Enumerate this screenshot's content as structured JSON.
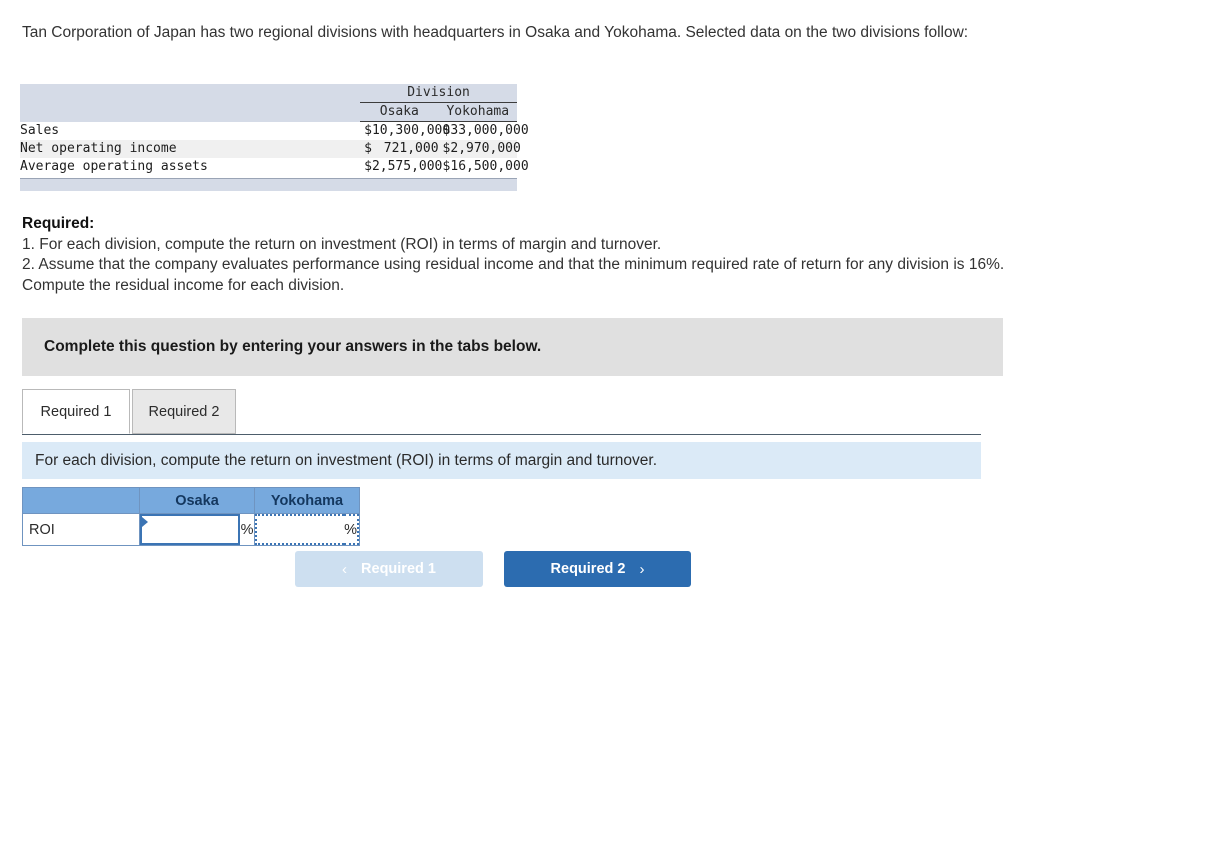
{
  "intro": "Tan Corporation of Japan has two regional divisions with headquarters in Osaka and Yokohama. Selected data on the two divisions follow:",
  "given_table": {
    "group_header": "Division",
    "columns": [
      "Osaka",
      "Yokohama"
    ],
    "rows": [
      {
        "label": "Sales",
        "osaka": "10,300,000",
        "yokohama": "33,000,000",
        "currency": "$"
      },
      {
        "label": "Net operating income",
        "osaka": "721,000",
        "yokohama": "2,970,000",
        "currency": "$"
      },
      {
        "label": "Average operating assets",
        "osaka": "2,575,000",
        "yokohama": "16,500,000",
        "currency": "$"
      }
    ]
  },
  "required": {
    "heading": "Required:",
    "item1": "1. For each division, compute the return on investment (ROI) in terms of margin and turnover.",
    "item2": "2. Assume that the company evaluates performance using residual income and that the minimum required rate of return for any division is 16%. Compute the residual income for each division."
  },
  "callout": "Complete this question by entering your answers in the tabs below.",
  "tabs": [
    {
      "label": "Required 1",
      "active": true
    },
    {
      "label": "Required 2",
      "active": false
    }
  ],
  "prompt": "For each division, compute the return on investment (ROI) in terms of margin and turnover.",
  "answer_table": {
    "headers": [
      "",
      "Osaka",
      "Yokohama"
    ],
    "rows": [
      {
        "label": "ROI",
        "osaka_value": "",
        "osaka_unit": "%",
        "yokohama_value": "",
        "yokohama_unit": "%"
      }
    ]
  },
  "nav": {
    "prev_label": "Required 1",
    "prev_icon": "chevron-left-icon",
    "prev_glyph": "‹",
    "next_label": "Required 2",
    "next_icon": "chevron-right-icon",
    "next_glyph": "›"
  },
  "colors": {
    "table_band": "#d5dbe7",
    "callout_bg": "#e0e0e0",
    "prompt_bg": "#dbeaf7",
    "answer_header_bg": "#77a9dd",
    "btn_primary": "#2c6cb0",
    "btn_disabled": "#cddff0",
    "focus_border": "#3b74b4"
  }
}
